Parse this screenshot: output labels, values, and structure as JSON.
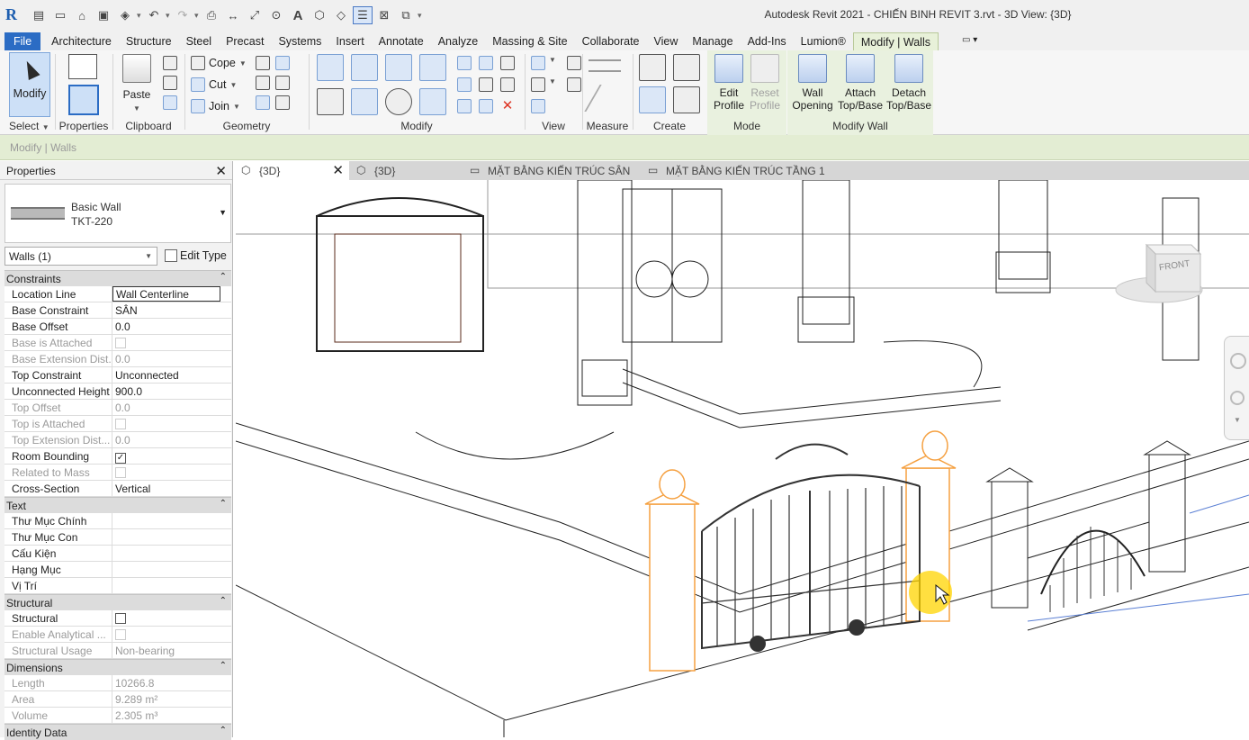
{
  "app": {
    "logo_letter": "R",
    "title": "Autodesk Revit 2021 - CHIẾN BINH REVIT 3.rvt - 3D View: {3D}"
  },
  "quick_access": [
    {
      "icon": "open-icon"
    },
    {
      "icon": "new-icon"
    },
    {
      "icon": "folder-icon"
    },
    {
      "icon": "save-icon"
    },
    {
      "icon": "sync-icon"
    },
    {
      "icon": "undo-icon"
    },
    {
      "icon": "redo-icon"
    },
    {
      "icon": "print-icon"
    },
    {
      "icon": "measure-icon"
    },
    {
      "icon": "dimension-icon"
    },
    {
      "icon": "tag-icon"
    },
    {
      "icon": "text-icon",
      "label": "A"
    },
    {
      "icon": "3d-view-icon"
    },
    {
      "icon": "section-icon"
    },
    {
      "icon": "thin-lines-icon"
    },
    {
      "icon": "close-hidden-icon"
    },
    {
      "icon": "switch-windows-icon"
    },
    {
      "icon": "customize-icon"
    }
  ],
  "ribbon_tabs": [
    {
      "label": "File",
      "kind": "file"
    },
    {
      "label": "Architecture"
    },
    {
      "label": "Structure"
    },
    {
      "label": "Steel"
    },
    {
      "label": "Precast"
    },
    {
      "label": "Systems"
    },
    {
      "label": "Insert"
    },
    {
      "label": "Annotate"
    },
    {
      "label": "Analyze"
    },
    {
      "label": "Massing & Site"
    },
    {
      "label": "Collaborate"
    },
    {
      "label": "View"
    },
    {
      "label": "Manage"
    },
    {
      "label": "Add-Ins"
    },
    {
      "label": "Lumion®"
    },
    {
      "label": "Modify | Walls",
      "kind": "active"
    }
  ],
  "ribbon": {
    "select": {
      "button": "Modify",
      "panel": "Select"
    },
    "properties": {
      "panel": "Properties"
    },
    "clipboard": {
      "paste": "Paste",
      "panel": "Clipboard"
    },
    "geometry": {
      "cope": "Cope",
      "cut": "Cut",
      "join": "Join",
      "panel": "Geometry"
    },
    "modify": {
      "panel": "Modify"
    },
    "view": {
      "panel": "View"
    },
    "measure": {
      "panel": "Measure"
    },
    "create": {
      "panel": "Create"
    },
    "mode": {
      "edit_profile_1": "Edit",
      "edit_profile_2": "Profile",
      "reset_profile_1": "Reset",
      "reset_profile_2": "Profile",
      "panel": "Mode"
    },
    "modify_wall": {
      "wall_opening_1": "Wall",
      "wall_opening_2": "Opening",
      "attach_1": "Attach",
      "attach_2": "Top/Base",
      "detach_1": "Detach",
      "detach_2": "Top/Base",
      "panel": "Modify Wall"
    }
  },
  "context_bar": {
    "text": "Modify | Walls"
  },
  "properties": {
    "header": "Properties",
    "type_family": "Basic Wall",
    "type_name": "TKT-220",
    "instance_filter": "Walls (1)",
    "edit_type": "Edit Type",
    "groups": [
      {
        "name": "Constraints",
        "rows": [
          {
            "k": "Location Line",
            "v": "Wall Centerline",
            "state": "boxed"
          },
          {
            "k": "Base Constraint",
            "v": "SÂN"
          },
          {
            "k": "Base Offset",
            "v": "0.0"
          },
          {
            "k": "Base is Attached",
            "v": "",
            "check": "off",
            "state": "dis"
          },
          {
            "k": "Base Extension Dist...",
            "v": "0.0",
            "state": "dis"
          },
          {
            "k": "Top Constraint",
            "v": "Unconnected"
          },
          {
            "k": "Unconnected Height",
            "v": "900.0"
          },
          {
            "k": "Top Offset",
            "v": "0.0",
            "state": "dis"
          },
          {
            "k": "Top is Attached",
            "v": "",
            "check": "off",
            "state": "dis"
          },
          {
            "k": "Top Extension Dist...",
            "v": "0.0",
            "state": "dis"
          },
          {
            "k": "Room Bounding",
            "v": "",
            "check": "on"
          },
          {
            "k": "Related to Mass",
            "v": "",
            "check": "off",
            "state": "dis"
          },
          {
            "k": "Cross-Section",
            "v": "Vertical"
          }
        ]
      },
      {
        "name": "Text",
        "rows": [
          {
            "k": "Thư Mục Chính",
            "v": ""
          },
          {
            "k": "Thư Mục Con",
            "v": ""
          },
          {
            "k": "Cấu Kiện",
            "v": ""
          },
          {
            "k": "Hạng Mục",
            "v": ""
          },
          {
            "k": "Vị Trí",
            "v": ""
          }
        ]
      },
      {
        "name": "Structural",
        "rows": [
          {
            "k": "Structural",
            "v": "",
            "check": "off"
          },
          {
            "k": "Enable Analytical ...",
            "v": "",
            "check": "off",
            "state": "dis"
          },
          {
            "k": "Structural Usage",
            "v": "Non-bearing",
            "state": "dis"
          }
        ]
      },
      {
        "name": "Dimensions",
        "rows": [
          {
            "k": "Length",
            "v": "10266.8",
            "state": "dis"
          },
          {
            "k": "Area",
            "v": "9.289 m²",
            "state": "dis"
          },
          {
            "k": "Volume",
            "v": "2.305 m³",
            "state": "dis"
          }
        ]
      },
      {
        "name": "Identity Data",
        "rows": []
      }
    ]
  },
  "view_tabs": [
    {
      "label": "{3D}",
      "active": true,
      "closable": true
    },
    {
      "label": "{3D}"
    },
    {
      "label": "MẶT BẰNG KIẾN TRÚC SÂN"
    },
    {
      "label": "MẶT BẰNG KIẾN TRÚC TẦNG 1"
    }
  ],
  "viewcube": {
    "face_label": "FRONT"
  },
  "colors": {
    "file_tab": "#2b6cc4",
    "context_tab": "#e8f1d9",
    "selection_orange": "#f5a040",
    "cursor_highlight": "#ffd400"
  }
}
